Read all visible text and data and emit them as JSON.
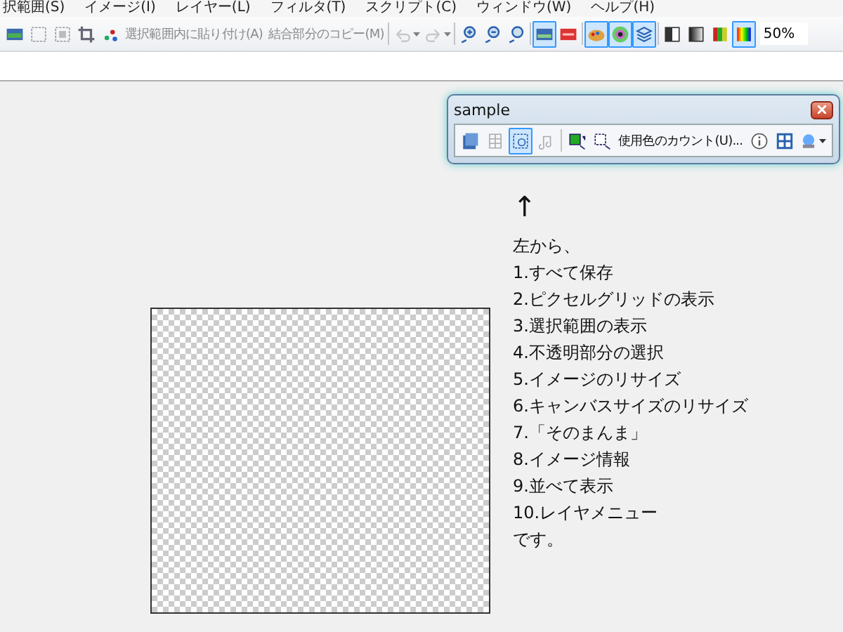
{
  "menu": [
    "択範囲(S)",
    "イメージ(I)",
    "レイヤー(L)",
    "フィルタ(T)",
    "スクリプト(C)",
    "ウィンドウ(W)",
    "ヘルプ(H)"
  ],
  "toolbar": {
    "items": [
      {
        "kind": "icon",
        "selected": false
      },
      {
        "kind": "icon",
        "selected": false
      },
      {
        "kind": "icon",
        "selected": false
      },
      {
        "kind": "icon",
        "selected": false
      },
      {
        "kind": "icon",
        "selected": false
      },
      {
        "kind": "text",
        "label": "選択範囲内に貼り付け(A)",
        "disabled": true
      },
      {
        "kind": "text",
        "label": "結合部分のコピー(M)",
        "disabled": true
      },
      {
        "kind": "separator"
      },
      {
        "kind": "dropdown",
        "disabled": true
      },
      {
        "kind": "dropdown",
        "disabled": true
      },
      {
        "kind": "separator"
      },
      {
        "kind": "icon",
        "selected": false
      },
      {
        "kind": "icon",
        "selected": false
      },
      {
        "kind": "icon",
        "selected": false
      },
      {
        "kind": "separator"
      },
      {
        "kind": "icon",
        "selected": true
      },
      {
        "kind": "icon",
        "selected": false
      },
      {
        "kind": "separator"
      },
      {
        "kind": "icon",
        "selected": true
      },
      {
        "kind": "icon",
        "selected": true
      },
      {
        "kind": "icon",
        "selected": true
      },
      {
        "kind": "separator"
      },
      {
        "kind": "icon",
        "selected": false
      },
      {
        "kind": "icon",
        "selected": false
      },
      {
        "kind": "icon",
        "selected": false
      },
      {
        "kind": "icon",
        "selected": true
      }
    ],
    "zoom": "50%"
  },
  "palette_window": {
    "title": "sample",
    "items": [
      {
        "kind": "icon",
        "selected": false
      },
      {
        "kind": "icon",
        "selected": false
      },
      {
        "kind": "icon",
        "selected": true
      },
      {
        "kind": "icon",
        "selected": false
      },
      {
        "kind": "separator"
      },
      {
        "kind": "icon",
        "selected": false
      },
      {
        "kind": "icon",
        "selected": false
      },
      {
        "kind": "text",
        "label": "使用色のカウント(U)...",
        "disabled": false
      },
      {
        "kind": "icon",
        "selected": false
      },
      {
        "kind": "icon",
        "selected": false
      },
      {
        "kind": "dropdown",
        "disabled": false
      }
    ]
  },
  "note": {
    "arrow": "↑",
    "lines": [
      "左から、",
      "1.すべて保存",
      "2.ピクセルグリッドの表示",
      "3.選択範囲の表示",
      "4.不透明部分の選択",
      "5.イメージのリサイズ",
      "6.キャンバスサイズのリサイズ",
      "7.「そのまんま」",
      "8.イメージ情報",
      "9.並べて表示",
      "10.レイヤメニュー",
      "です。"
    ]
  }
}
